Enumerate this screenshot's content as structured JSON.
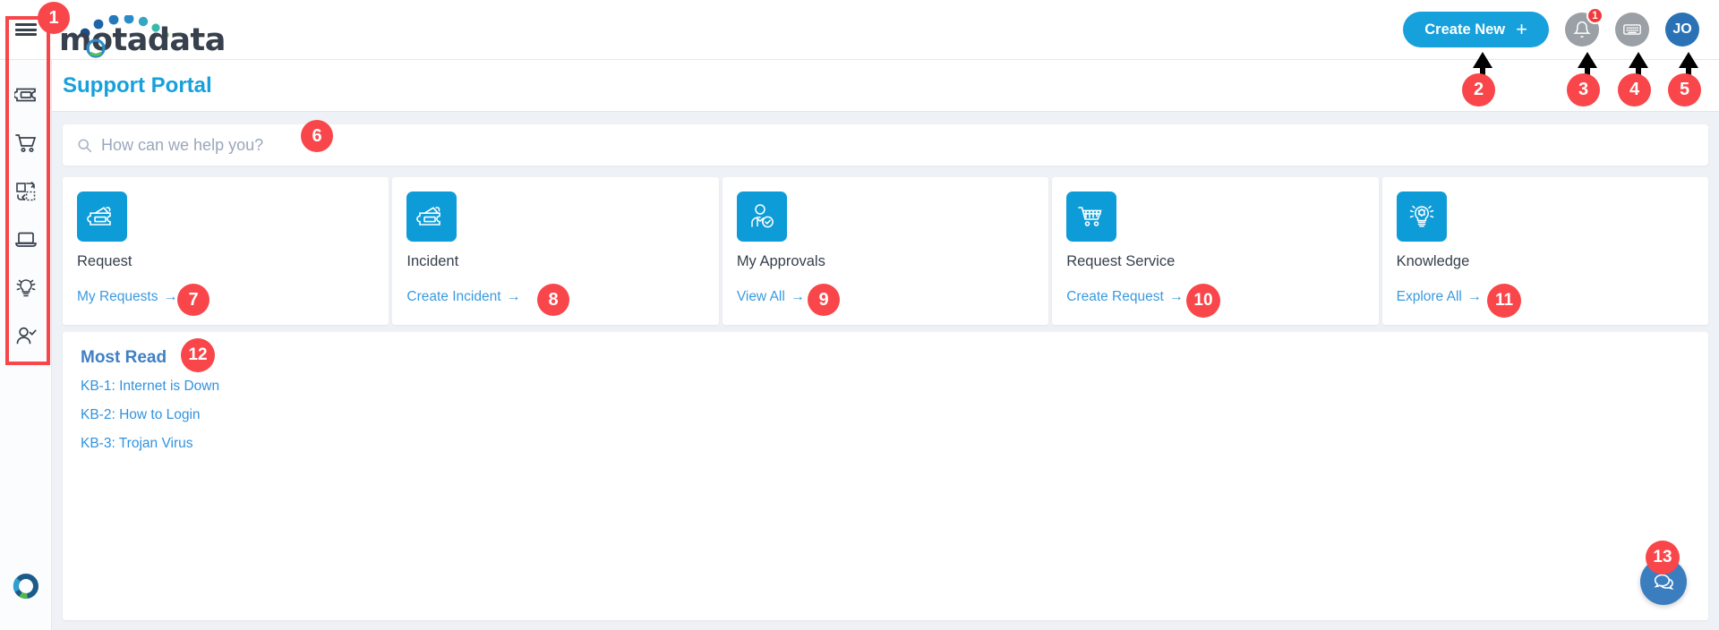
{
  "app": {
    "brand_name": "motadata",
    "page_title": "Support Portal"
  },
  "topbar": {
    "menu_icon": "hamburger-icon",
    "create_new_label": "Create New",
    "create_new_plus": "+",
    "notification_icon": "bell-icon",
    "notification_count": "1",
    "keyboard_icon": "keyboard-icon",
    "avatar_initials": "JO"
  },
  "sidebar": {
    "items": [
      {
        "icon": "ticket-icon",
        "name": "sidebar-item-tickets"
      },
      {
        "icon": "shopping-cart-icon",
        "name": "sidebar-item-service-catalog"
      },
      {
        "icon": "exchange-swap-icon",
        "name": "sidebar-item-requests"
      },
      {
        "icon": "laptop-icon",
        "name": "sidebar-item-assets"
      },
      {
        "icon": "lightbulb-icon",
        "name": "sidebar-item-knowledge"
      },
      {
        "icon": "user-check-icon",
        "name": "sidebar-item-approvals"
      }
    ],
    "footer_logo": "donut-ring-logo"
  },
  "search": {
    "placeholder": "How can we help you?",
    "value": "",
    "icon": "search-icon"
  },
  "cards": [
    {
      "icon": "ticket-icon",
      "title": "Request",
      "link_label": "My Requests",
      "arrow": "→"
    },
    {
      "icon": "ticket-icon",
      "title": "Incident",
      "link_label": "Create Incident",
      "arrow": "→"
    },
    {
      "icon": "approval-user-icon",
      "title": "My Approvals",
      "link_label": "View All",
      "arrow": "→"
    },
    {
      "icon": "shopping-cart-icon",
      "title": "Request Service",
      "link_label": "Create Request",
      "arrow": "→"
    },
    {
      "icon": "bulb-gear-icon",
      "title": "Knowledge",
      "link_label": "Explore All",
      "arrow": "→"
    }
  ],
  "most_read": {
    "title": "Most Read",
    "articles": [
      "KB-1: Internet is Down",
      "KB-2: How to Login",
      "KB-3: Trojan Virus"
    ]
  },
  "chat": {
    "icon": "chat-bubbles-icon"
  },
  "annotations": {
    "markers": [
      "1",
      "2",
      "3",
      "4",
      "5",
      "6",
      "7",
      "8",
      "9",
      "10",
      "11",
      "12",
      "13"
    ],
    "color": "#f9464a"
  },
  "colors": {
    "accent_blue": "#16a0dc",
    "link_blue": "#3a9ae0",
    "panel_title_blue": "#3f7fc4",
    "marker_red": "#f9464a",
    "avatar_blue": "#2a72b5",
    "chat_blue": "#3a7ec0",
    "page_bg": "#eef1f5"
  }
}
